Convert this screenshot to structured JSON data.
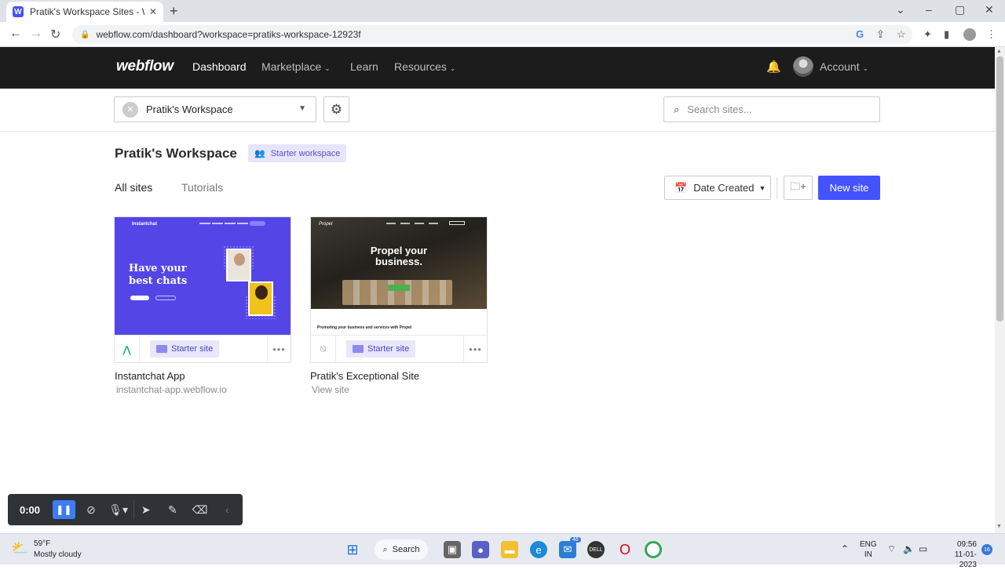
{
  "browser": {
    "tab_title": "Pratik's Workspace Sites - Webflow",
    "favicon_letter": "W",
    "url": "webflow.com/dashboard?workspace=pratiks-workspace-12923f"
  },
  "nav": {
    "logo": "webflow",
    "items": [
      "Dashboard",
      "Marketplace",
      "Learn",
      "Resources"
    ],
    "account_label": "Account"
  },
  "workspace_bar": {
    "selected_workspace": "Pratik's Workspace",
    "search_placeholder": "Search sites..."
  },
  "header": {
    "title": "Pratik's Workspace",
    "badge": "Starter workspace"
  },
  "tabs": [
    "All sites",
    "Tutorials"
  ],
  "toolbar": {
    "sort_label": "Date Created",
    "new_site_label": "New site"
  },
  "sites": [
    {
      "name": "Instantchat App",
      "subtitle": "instantchat-app.webflow.io",
      "plan": "Starter site",
      "thumb": {
        "brand": "Instantchat",
        "headline_1": "Have your",
        "headline_2": "best chats"
      }
    },
    {
      "name": "Pratik's Exceptional Site",
      "subtitle": "View site",
      "plan": "Starter site",
      "thumb": {
        "brand": "Propel",
        "headline_1": "Propel your",
        "headline_2": "business.",
        "sub": "Promoting your business and services with Propel"
      }
    }
  ],
  "recorder": {
    "time": "0:00"
  },
  "taskbar": {
    "temp": "59°F",
    "weather": "Mostly cloudy",
    "search_label": "Search",
    "mail_badge": "46",
    "lang_1": "ENG",
    "lang_2": "IN",
    "time": "09:56",
    "date": "11-01-2023",
    "notif_count": "16"
  },
  "colors": {
    "brand_blue": "#4353ff",
    "nav_bg": "#1c1c1c",
    "badge_bg": "#e7e5fb",
    "badge_text": "#5a52c9"
  }
}
